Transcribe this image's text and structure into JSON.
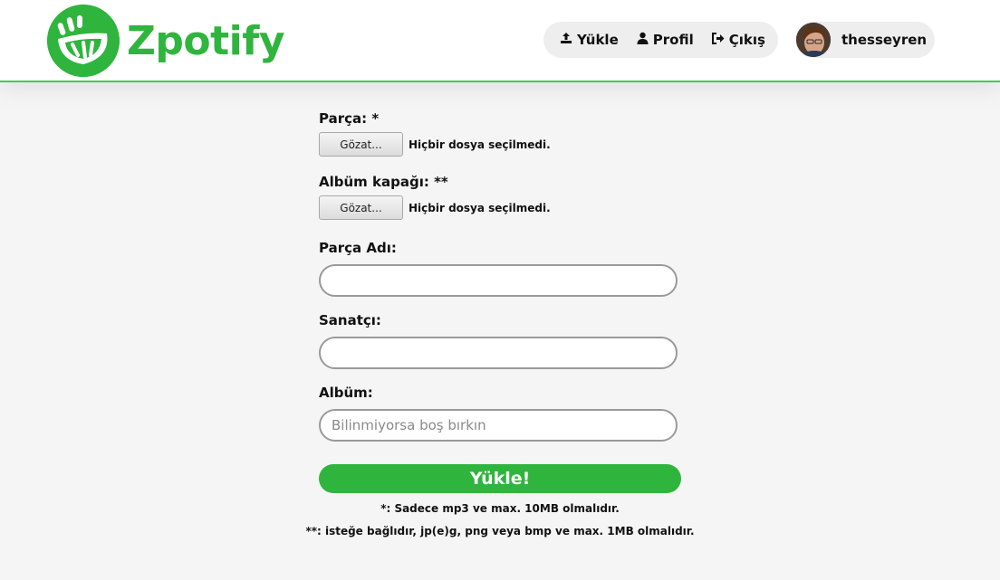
{
  "app": {
    "name": "Zpotify",
    "brand_color": "#2fb53d",
    "logo_icon": "smiling-mouth-logo"
  },
  "nav": {
    "items": [
      {
        "icon": "upload-icon",
        "label": "Yükle"
      },
      {
        "icon": "user-icon",
        "label": "Profil"
      },
      {
        "icon": "sign-out-icon",
        "label": "Çıkış"
      }
    ]
  },
  "user": {
    "username": "thesseyren",
    "avatar": "user-avatar-photo"
  },
  "form": {
    "track": {
      "label": "Parça: *",
      "button": "Gözat...",
      "status": "Hiçbir dosya seçilmedi."
    },
    "cover": {
      "label": "Albüm kapağı: **",
      "button": "Gözat...",
      "status": "Hiçbir dosya seçilmedi."
    },
    "track_name": {
      "label": "Parça Adı:",
      "value": "",
      "placeholder": ""
    },
    "artist": {
      "label": "Sanatçı:",
      "value": "",
      "placeholder": ""
    },
    "album": {
      "label": "Albüm:",
      "value": "",
      "placeholder": "Bilinmiyorsa boş bırkın"
    },
    "submit": "Yükle!"
  },
  "notes": [
    "*: Sadece mp3 ve max. 10MB olmalıdır.",
    "**: isteğe bağlıdır, jp(e)g, png veya bmp ve max. 1MB olmalıdır."
  ]
}
